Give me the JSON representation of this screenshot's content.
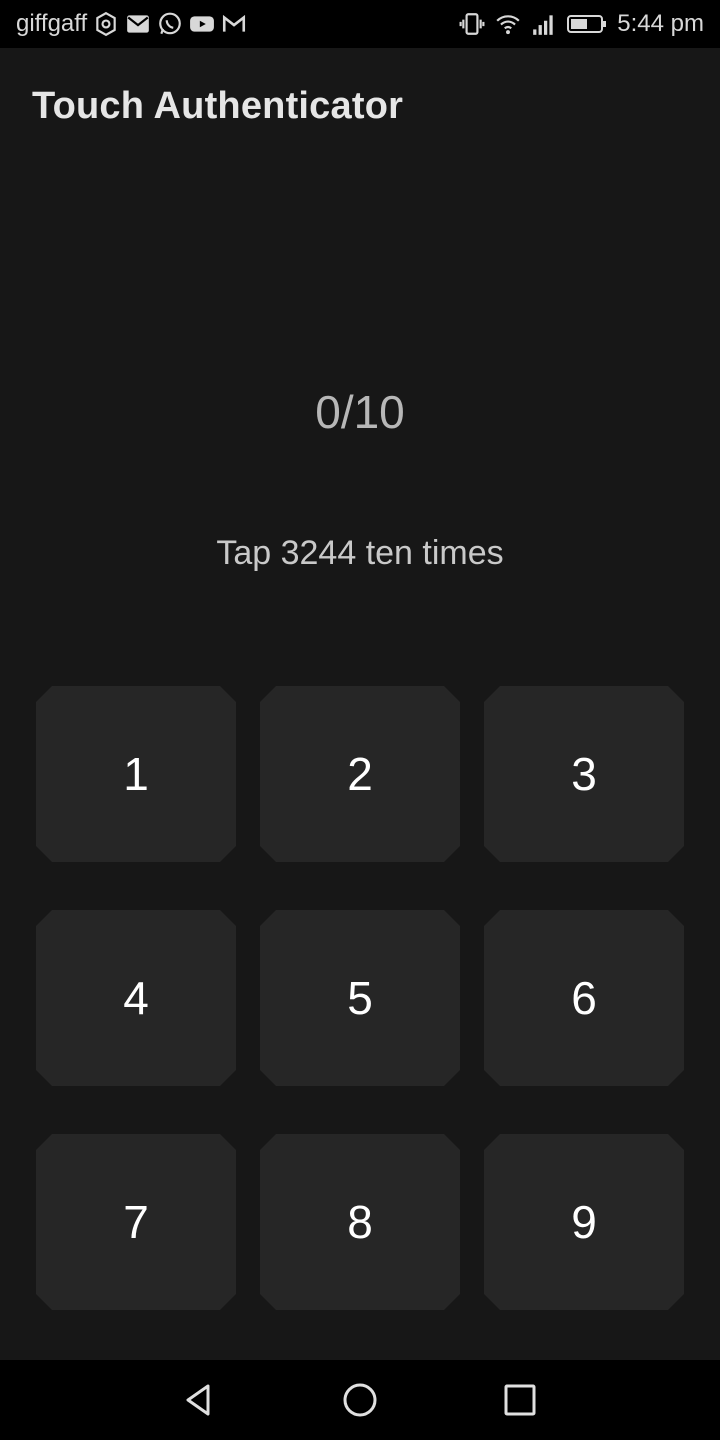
{
  "status_bar": {
    "carrier": "giffgaff",
    "time": "5:44 pm",
    "left_icons": [
      "shield-icon",
      "mail-icon",
      "whatsapp-icon",
      "youtube-icon",
      "gmail-icon"
    ],
    "right_icons": [
      "vibrate-icon",
      "wifi-icon",
      "signal-icon",
      "battery-icon"
    ]
  },
  "app": {
    "title": "Touch Authenticator"
  },
  "progress": {
    "text": "0/10",
    "current": 0,
    "total": 10
  },
  "instruction": "Tap 3244 ten times",
  "keypad": [
    "1",
    "2",
    "3",
    "4",
    "5",
    "6",
    "7",
    "8",
    "9"
  ],
  "nav": [
    "back",
    "home",
    "recents"
  ]
}
